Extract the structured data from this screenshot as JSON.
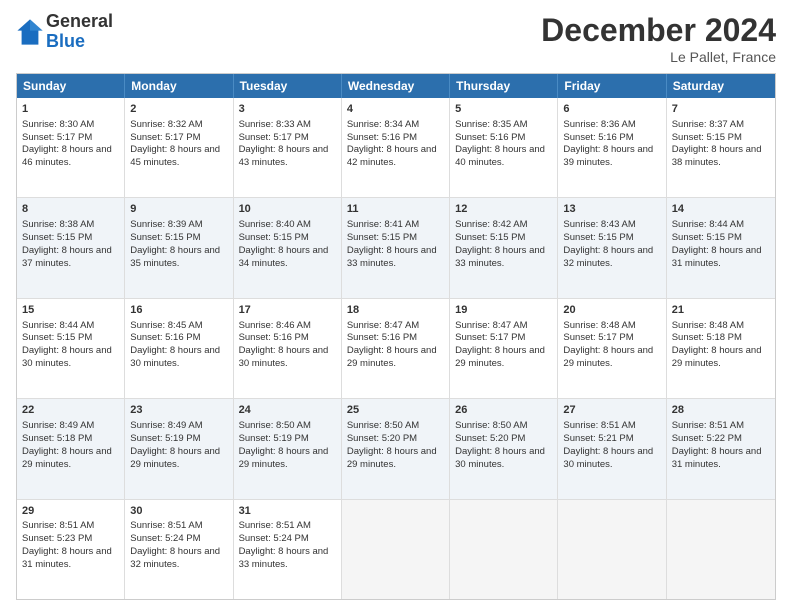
{
  "header": {
    "month_title": "December 2024",
    "location": "Le Pallet, France",
    "logo_general": "General",
    "logo_blue": "Blue"
  },
  "days_of_week": [
    "Sunday",
    "Monday",
    "Tuesday",
    "Wednesday",
    "Thursday",
    "Friday",
    "Saturday"
  ],
  "rows": [
    [
      {
        "day": "1",
        "sunrise": "Sunrise: 8:30 AM",
        "sunset": "Sunset: 5:17 PM",
        "daylight": "Daylight: 8 hours and 46 minutes."
      },
      {
        "day": "2",
        "sunrise": "Sunrise: 8:32 AM",
        "sunset": "Sunset: 5:17 PM",
        "daylight": "Daylight: 8 hours and 45 minutes."
      },
      {
        "day": "3",
        "sunrise": "Sunrise: 8:33 AM",
        "sunset": "Sunset: 5:17 PM",
        "daylight": "Daylight: 8 hours and 43 minutes."
      },
      {
        "day": "4",
        "sunrise": "Sunrise: 8:34 AM",
        "sunset": "Sunset: 5:16 PM",
        "daylight": "Daylight: 8 hours and 42 minutes."
      },
      {
        "day": "5",
        "sunrise": "Sunrise: 8:35 AM",
        "sunset": "Sunset: 5:16 PM",
        "daylight": "Daylight: 8 hours and 40 minutes."
      },
      {
        "day": "6",
        "sunrise": "Sunrise: 8:36 AM",
        "sunset": "Sunset: 5:16 PM",
        "daylight": "Daylight: 8 hours and 39 minutes."
      },
      {
        "day": "7",
        "sunrise": "Sunrise: 8:37 AM",
        "sunset": "Sunset: 5:15 PM",
        "daylight": "Daylight: 8 hours and 38 minutes."
      }
    ],
    [
      {
        "day": "8",
        "sunrise": "Sunrise: 8:38 AM",
        "sunset": "Sunset: 5:15 PM",
        "daylight": "Daylight: 8 hours and 37 minutes."
      },
      {
        "day": "9",
        "sunrise": "Sunrise: 8:39 AM",
        "sunset": "Sunset: 5:15 PM",
        "daylight": "Daylight: 8 hours and 35 minutes."
      },
      {
        "day": "10",
        "sunrise": "Sunrise: 8:40 AM",
        "sunset": "Sunset: 5:15 PM",
        "daylight": "Daylight: 8 hours and 34 minutes."
      },
      {
        "day": "11",
        "sunrise": "Sunrise: 8:41 AM",
        "sunset": "Sunset: 5:15 PM",
        "daylight": "Daylight: 8 hours and 33 minutes."
      },
      {
        "day": "12",
        "sunrise": "Sunrise: 8:42 AM",
        "sunset": "Sunset: 5:15 PM",
        "daylight": "Daylight: 8 hours and 33 minutes."
      },
      {
        "day": "13",
        "sunrise": "Sunrise: 8:43 AM",
        "sunset": "Sunset: 5:15 PM",
        "daylight": "Daylight: 8 hours and 32 minutes."
      },
      {
        "day": "14",
        "sunrise": "Sunrise: 8:44 AM",
        "sunset": "Sunset: 5:15 PM",
        "daylight": "Daylight: 8 hours and 31 minutes."
      }
    ],
    [
      {
        "day": "15",
        "sunrise": "Sunrise: 8:44 AM",
        "sunset": "Sunset: 5:15 PM",
        "daylight": "Daylight: 8 hours and 30 minutes."
      },
      {
        "day": "16",
        "sunrise": "Sunrise: 8:45 AM",
        "sunset": "Sunset: 5:16 PM",
        "daylight": "Daylight: 8 hours and 30 minutes."
      },
      {
        "day": "17",
        "sunrise": "Sunrise: 8:46 AM",
        "sunset": "Sunset: 5:16 PM",
        "daylight": "Daylight: 8 hours and 30 minutes."
      },
      {
        "day": "18",
        "sunrise": "Sunrise: 8:47 AM",
        "sunset": "Sunset: 5:16 PM",
        "daylight": "Daylight: 8 hours and 29 minutes."
      },
      {
        "day": "19",
        "sunrise": "Sunrise: 8:47 AM",
        "sunset": "Sunset: 5:17 PM",
        "daylight": "Daylight: 8 hours and 29 minutes."
      },
      {
        "day": "20",
        "sunrise": "Sunrise: 8:48 AM",
        "sunset": "Sunset: 5:17 PM",
        "daylight": "Daylight: 8 hours and 29 minutes."
      },
      {
        "day": "21",
        "sunrise": "Sunrise: 8:48 AM",
        "sunset": "Sunset: 5:18 PM",
        "daylight": "Daylight: 8 hours and 29 minutes."
      }
    ],
    [
      {
        "day": "22",
        "sunrise": "Sunrise: 8:49 AM",
        "sunset": "Sunset: 5:18 PM",
        "daylight": "Daylight: 8 hours and 29 minutes."
      },
      {
        "day": "23",
        "sunrise": "Sunrise: 8:49 AM",
        "sunset": "Sunset: 5:19 PM",
        "daylight": "Daylight: 8 hours and 29 minutes."
      },
      {
        "day": "24",
        "sunrise": "Sunrise: 8:50 AM",
        "sunset": "Sunset: 5:19 PM",
        "daylight": "Daylight: 8 hours and 29 minutes."
      },
      {
        "day": "25",
        "sunrise": "Sunrise: 8:50 AM",
        "sunset": "Sunset: 5:20 PM",
        "daylight": "Daylight: 8 hours and 29 minutes."
      },
      {
        "day": "26",
        "sunrise": "Sunrise: 8:50 AM",
        "sunset": "Sunset: 5:20 PM",
        "daylight": "Daylight: 8 hours and 30 minutes."
      },
      {
        "day": "27",
        "sunrise": "Sunrise: 8:51 AM",
        "sunset": "Sunset: 5:21 PM",
        "daylight": "Daylight: 8 hours and 30 minutes."
      },
      {
        "day": "28",
        "sunrise": "Sunrise: 8:51 AM",
        "sunset": "Sunset: 5:22 PM",
        "daylight": "Daylight: 8 hours and 31 minutes."
      }
    ],
    [
      {
        "day": "29",
        "sunrise": "Sunrise: 8:51 AM",
        "sunset": "Sunset: 5:23 PM",
        "daylight": "Daylight: 8 hours and 31 minutes."
      },
      {
        "day": "30",
        "sunrise": "Sunrise: 8:51 AM",
        "sunset": "Sunset: 5:24 PM",
        "daylight": "Daylight: 8 hours and 32 minutes."
      },
      {
        "day": "31",
        "sunrise": "Sunrise: 8:51 AM",
        "sunset": "Sunset: 5:24 PM",
        "daylight": "Daylight: 8 hours and 33 minutes."
      },
      null,
      null,
      null,
      null
    ]
  ]
}
